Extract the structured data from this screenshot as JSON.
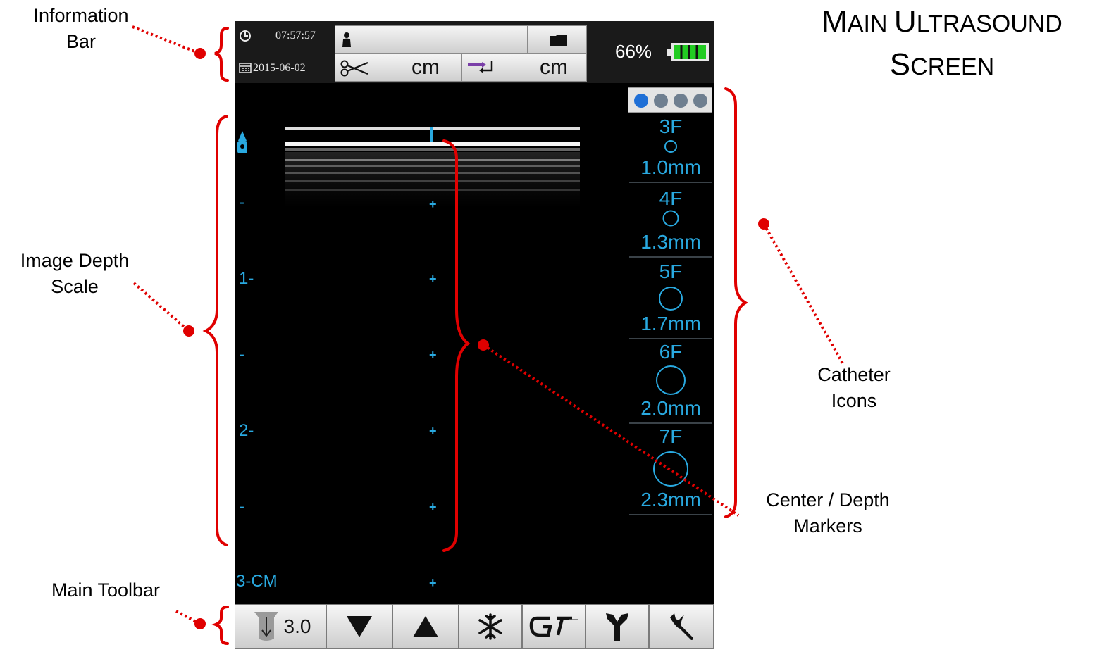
{
  "title": {
    "line1_big1": "M",
    "line1_rest1": "AIN ",
    "line1_big2": "U",
    "line1_rest2": "LTRASOUND",
    "line2_big": "S",
    "line2_rest": "CREEN"
  },
  "annotations": {
    "information_bar": [
      "Information",
      "Bar"
    ],
    "image_depth_scale": [
      "Image Depth",
      "Scale"
    ],
    "main_toolbar": "Main Toolbar",
    "catheter_icons": [
      "Catheter",
      "Icons"
    ],
    "center_depth_markers": [
      "Center / Depth",
      "Markers"
    ]
  },
  "info_bar": {
    "time": "07:57:57",
    "date": "2015-06-02",
    "unit1": "cm",
    "unit2": "cm",
    "battery_percent": "66%"
  },
  "depth_scale": {
    "labels": [
      "-",
      "1-",
      "-",
      "2-",
      "-",
      "3-CM"
    ]
  },
  "catheters": [
    {
      "size": "3F",
      "diameter": "1.0mm"
    },
    {
      "size": "4F",
      "diameter": "1.3mm"
    },
    {
      "size": "5F",
      "diameter": "1.7mm"
    },
    {
      "size": "6F",
      "diameter": "2.0mm"
    },
    {
      "size": "7F",
      "diameter": "2.3mm"
    }
  ],
  "toolbar": {
    "depth_value": "3.0",
    "icons": [
      "depth-icon",
      "down-arrow-icon",
      "up-arrow-icon",
      "freeze-snowflake-icon",
      "gi-logo-icon",
      "y-connector-icon",
      "wrench-icon"
    ]
  },
  "colors": {
    "accent": "#29a9e0",
    "annotation": "#e00000",
    "battery": "#22cc22"
  }
}
